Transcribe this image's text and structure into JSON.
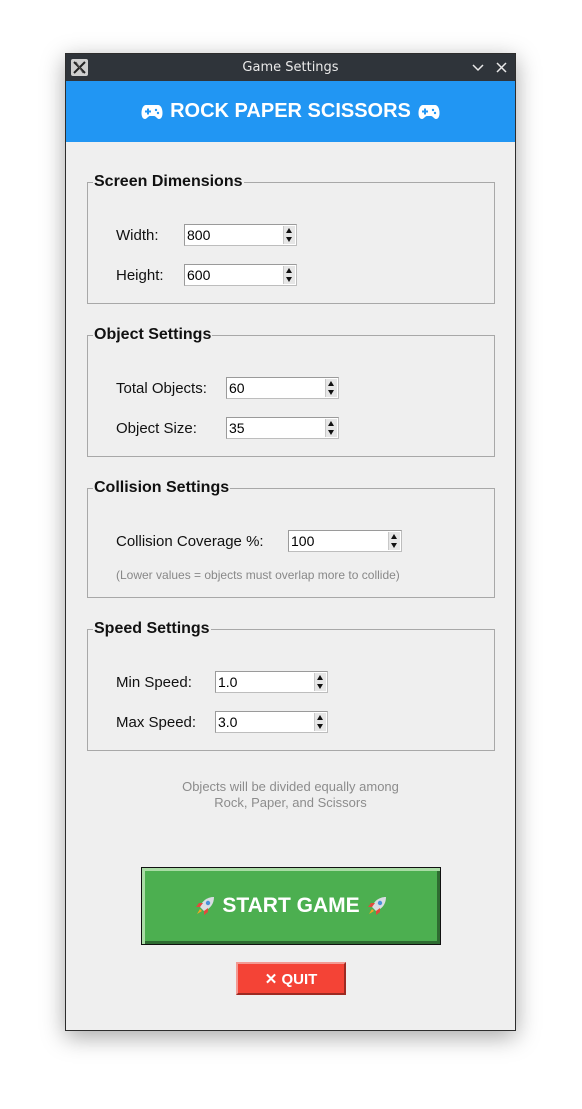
{
  "window": {
    "title": "Game Settings"
  },
  "header": {
    "title": "ROCK PAPER SCISSORS"
  },
  "screen": {
    "legend": "Screen Dimensions",
    "width_label": "Width:",
    "width_value": "800",
    "height_label": "Height:",
    "height_value": "600"
  },
  "objects": {
    "legend": "Object Settings",
    "total_label": "Total Objects:",
    "total_value": "60",
    "size_label": "Object Size:",
    "size_value": "35"
  },
  "collision": {
    "legend": "Collision Settings",
    "coverage_label": "Collision Coverage %:",
    "coverage_value": "100",
    "hint": "(Lower values = objects must overlap more to collide)"
  },
  "speed": {
    "legend": "Speed Settings",
    "min_label": "Min Speed:",
    "min_value": "1.0",
    "max_label": "Max Speed:",
    "max_value": "3.0"
  },
  "note": {
    "line1": "Objects will be divided equally among",
    "line2": "Rock, Paper, and Scissors"
  },
  "buttons": {
    "start_label": "START GAME",
    "quit_label": "✕ QUIT"
  },
  "colors": {
    "header": "#2196f3",
    "start": "#4caf50",
    "quit": "#f44336"
  },
  "icons": {
    "header": "gamepad-icon",
    "start": "rocket-icon"
  }
}
